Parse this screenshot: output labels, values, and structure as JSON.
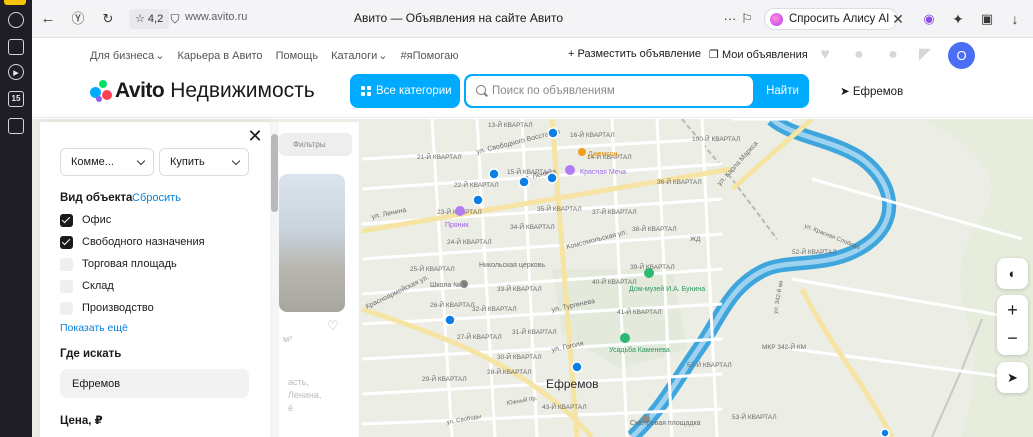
{
  "browser": {
    "rating": "4,2",
    "url": "www.avito.ru",
    "title": "Авито — Объявления на сайте Авито",
    "alice_label": "Спросить Алису AI",
    "side_badge": "15"
  },
  "header": {
    "nav": [
      "Для бизнеса",
      "Карьера в Авито",
      "Помощь",
      "Каталоги",
      "#яПомогаю"
    ],
    "post_ad": "+ Разместить объявление",
    "my_ads": "Мои объявления",
    "avatar_letter": "O",
    "logo_text": "Avito",
    "logo_sub": "Недвижимость",
    "all_categories": "Все категории",
    "search_placeholder": "Поиск по объявлениям",
    "find_label": "Найти",
    "city": "Ефремов",
    "accent": "#00aaff"
  },
  "filters": {
    "category_select": "Комме...",
    "deal_select": "Купить",
    "object_type_heading": "Вид объекта",
    "reset_link": "Сбросить",
    "object_types": [
      {
        "label": "Офис",
        "checked": true
      },
      {
        "label": "Свободного назначения",
        "checked": true
      },
      {
        "label": "Торговая площадь",
        "checked": false
      },
      {
        "label": "Склад",
        "checked": false
      },
      {
        "label": "Производство",
        "checked": false
      }
    ],
    "show_more": "Показать ещё",
    "where_heading": "Где искать",
    "where_value": "Ефремов",
    "price_heading": "Цена, ₽"
  },
  "listing": {
    "filters_chip": "Фильтры",
    "area_fragment": "м²",
    "line1": "асть,",
    "line2": "Ленина,",
    "line3": "ё"
  },
  "map": {
    "city_label": "Ефремов",
    "labels": {
      "svob_vosst": "ул. Свободного Восстания",
      "lenina_top": "ул. Ленина",
      "lenina_left": "ул. Ленина",
      "komsomol": "Комсомольская ул.",
      "krasnoarm": "Красноармейская ул.",
      "turgeneva": "ул. Тургенева",
      "gogolya": "ул. Гоголя",
      "marksa": "ул. Карла Маркса",
      "krasnaya_mecha": "Красная Меча",
      "dzhemson": "Джемсон",
      "pryanik": "Пряник",
      "school": "Школа № 9",
      "church": "Никольская церковь",
      "museum": "Дом-музей И.А. Бунина",
      "usadba": "Усадьба Каменева",
      "smotrovaya": "Смотровая площадка",
      "k16": "16-Й КВАРТАЛ",
      "k13": "13-Й КВАРТАЛ",
      "k21": "21-Й КВАРТАЛ",
      "k22": "22-Й КВАРТАЛ",
      "k23": "23-Й КВАРТАЛ",
      "k24": "24-Й КВАРТАЛ",
      "k25": "25-Й КВАРТАЛ",
      "k26": "26-Й КВАРТАЛ",
      "k27": "27-Й КВАРТАЛ",
      "k28": "28-Й КВАРТАЛ",
      "k29": "29-Й КВАРТАЛ",
      "k30": "30-Й КВАРТАЛ",
      "k31": "31-Й КВАРТАЛ",
      "k32": "32-Й КВАРТАЛ",
      "k33": "33-Й КВАРТАЛ",
      "k34": "34-Й КВАРТАЛ",
      "k35": "35-Й КВАРТАЛ",
      "k14": "14-Й КВАРТАЛ",
      "k15": "15-Й КВАРТАЛ",
      "k36": "36-Й КВАРТАЛ",
      "k37": "37-Й КВАРТАЛ",
      "k38": "38-Й КВАРТАЛ",
      "k39": "39-Й КВАРТАЛ",
      "k40": "40-Й КВАРТАЛ",
      "k41": "41-Й КВАРТАЛ",
      "k43": "43-Й КВАРТАЛ",
      "k52": "52-Й КВАРТАЛ",
      "k53": "53-Й КВАРТАЛ",
      "k57": "57-Й КВАРТАЛ",
      "k100": "100-Й КВАРТАЛ",
      "k342": "МКР 342-Й КМ",
      "road342": "ул. 342-й км",
      "zhd": "ЖД",
      "krasnaya_sloboda": "ул. Красная Слобода",
      "yuzhny": "Южный пр.",
      "svobody": "ул. Свободы"
    },
    "zoom_in": "+",
    "zoom_out": "−",
    "route_colors": {
      "water": "#a8d8ee",
      "river": "#3fa6dd",
      "road": "#ffffff",
      "major_road": "#f3e3a8"
    }
  }
}
